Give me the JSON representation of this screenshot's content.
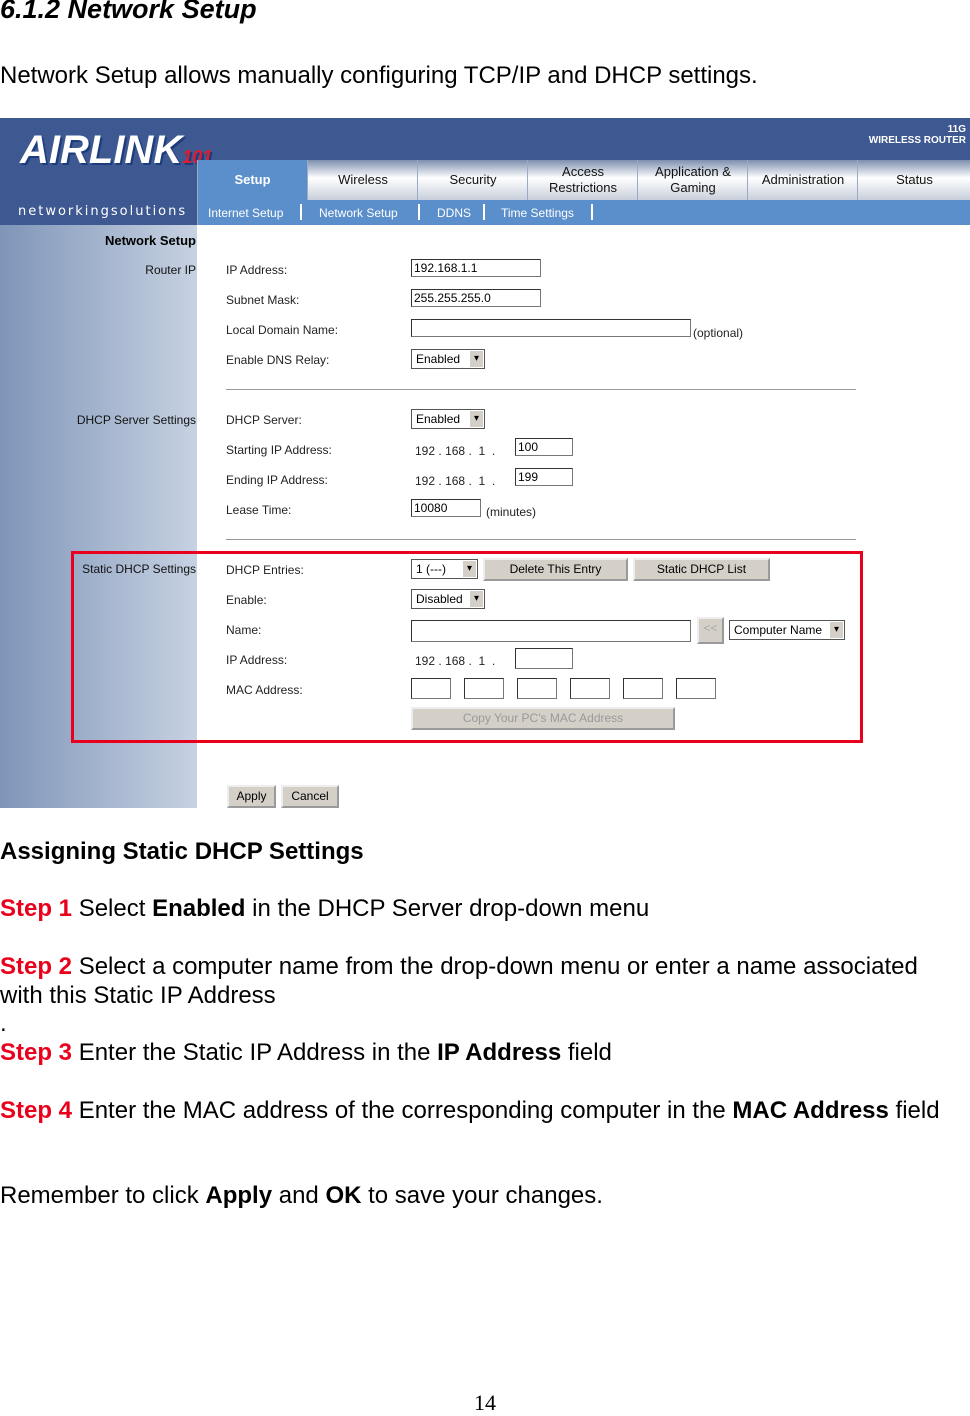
{
  "heading": "6.1.2 Network Setup",
  "intro": "Network Setup allows manually configuring TCP/IP and DHCP settings.",
  "router": {
    "logo": "AIRLINK",
    "logo_num": "101",
    "tagline": "networkingsolutions",
    "brand": "WIRELESS ROUTER",
    "brand_sup": "11G",
    "tabs": [
      "Setup",
      "Wireless",
      "Security",
      "Access Restrictions",
      "Application & Gaming",
      "Administration",
      "Status"
    ],
    "subtabs": [
      "Internet Setup",
      "Network Setup",
      "DDNS",
      "Time Settings"
    ],
    "page_title": "Network Setup",
    "sections": {
      "router_ip": "Router IP",
      "dhcp": "DHCP Server Settings",
      "static": "Static DHCP Settings"
    },
    "fields": {
      "ip_label": "IP Address:",
      "ip_value": "192.168.1.1",
      "mask_label": "Subnet Mask:",
      "mask_value": "255.255.255.0",
      "domain_label": "Local Domain Name:",
      "domain_value": "",
      "optional": "(optional)",
      "dns_label": "Enable DNS Relay:",
      "dns_value": "Enabled",
      "dhcp_label": "DHCP Server:",
      "dhcp_value": "Enabled",
      "start_label": "Starting IP Address:",
      "start_value": "100",
      "end_label": "Ending IP Address:",
      "end_value": "199",
      "prefix": [
        "192",
        ".",
        "168",
        ".",
        "1",
        "."
      ],
      "lease_label": "Lease Time:",
      "lease_value": "10080",
      "minutes": "(minutes)",
      "entries_label": "DHCP Entries:",
      "entries_value": "1 (---)",
      "delete_btn": "Delete This Entry",
      "list_btn": "Static DHCP List",
      "enable_label": "Enable:",
      "enable_value": "Disabled",
      "name_label": "Name:",
      "name_value": "",
      "arrow_btn": "<<",
      "computer_name": "Computer Name",
      "sip_label": "IP Address:",
      "sip_value": "",
      "mac_label": "MAC Address:",
      "copy_btn": "Copy Your PC's MAC Address"
    },
    "apply": "Apply",
    "cancel": "Cancel",
    "highlight_color": "#e8001c"
  },
  "section_title": "Assigning Static DHCP Settings",
  "steps": [
    {
      "num": "Step 1",
      "parts": [
        " Select ",
        "Enabled",
        " in the DHCP Server drop-down menu"
      ]
    },
    {
      "num": "Step 2",
      "parts": [
        " Select a computer name from the drop-down menu or enter a name associated with this Static IP Address"
      ]
    },
    {
      "num": "Step 3",
      "parts": [
        " Enter the Static IP Address in the ",
        "IP Address",
        " field"
      ]
    },
    {
      "num": "Step 4",
      "parts": [
        " Enter the MAC address of the corresponding computer in the ",
        "MAC Address",
        " field"
      ]
    }
  ],
  "stray_dot": ".",
  "remember": [
    "Remember to click ",
    "Apply",
    " and ",
    "OK",
    " to save your changes."
  ],
  "page_number": "14"
}
